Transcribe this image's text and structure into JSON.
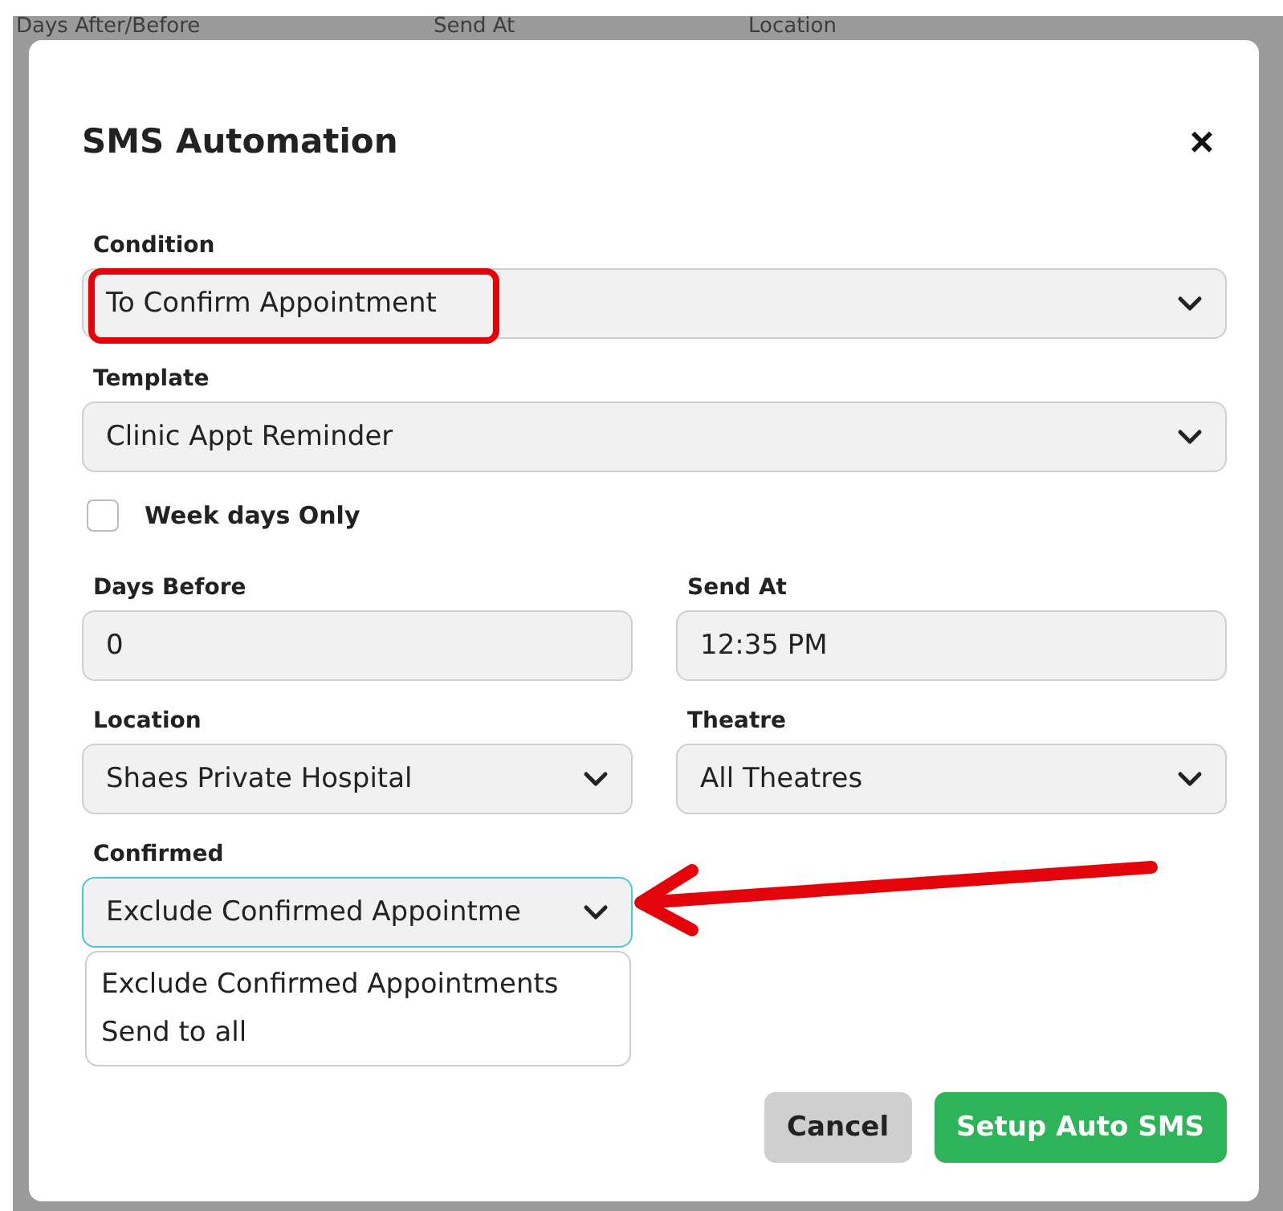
{
  "background_table": {
    "columns": [
      "Days After/Before",
      "Send At",
      "Location"
    ]
  },
  "dialog": {
    "title": "SMS Automation",
    "close": "×",
    "condition": {
      "label": "Condition",
      "value": "To Confirm Appointment",
      "highlighted": true
    },
    "template": {
      "label": "Template",
      "value": "Clinic Appt Reminder"
    },
    "week_days_only": {
      "label": "Week days Only",
      "checked": false
    },
    "days_before": {
      "label": "Days Before",
      "value": "0"
    },
    "send_at": {
      "label": "Send At",
      "value": "12:35 PM"
    },
    "location": {
      "label": "Location",
      "value": "Shaes Private Hospital"
    },
    "theatre": {
      "label": "Theatre",
      "value": "All Theatres"
    },
    "confirmed": {
      "label": "Confirmed",
      "value": "Exclude Confirmed Appointme",
      "focused": true,
      "open": true,
      "arrow_pointer": true,
      "options": [
        {
          "label": "Exclude Confirmed Appointments"
        },
        {
          "label": "Send to all"
        }
      ]
    },
    "buttons": [
      {
        "label": "Cancel",
        "kind": "secondary"
      },
      {
        "label": "Setup Auto SMS",
        "kind": "primary"
      }
    ]
  }
}
